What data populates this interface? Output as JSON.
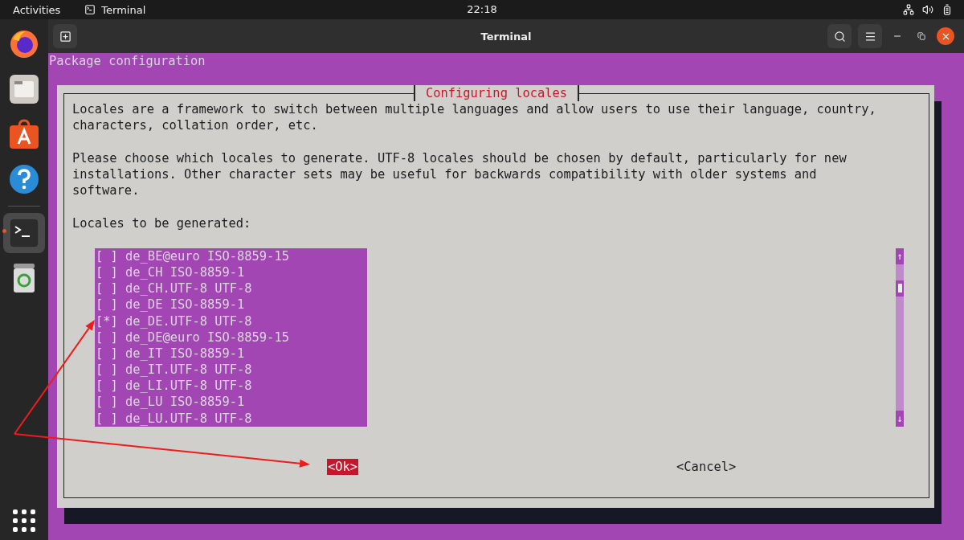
{
  "top_bar": {
    "activities": "Activities",
    "app": "Terminal",
    "clock": "22:18"
  },
  "window": {
    "title": "Terminal"
  },
  "terminal": {
    "header": "Package configuration",
    "dialog": {
      "title": "Configuring locales",
      "paragraphs": [
        "Locales are a framework to switch between multiple languages and allow users to use their language, country,\ncharacters, collation order, etc.",
        "Please choose which locales to generate. UTF-8 locales should be chosen by default, particularly for new\ninstallations. Other character sets may be useful for backwards compatibility with older systems and\nsoftware."
      ],
      "prompt": "Locales to be generated:",
      "checkbox": {
        "on": "[*]",
        "off": "[ ]"
      },
      "locales": [
        {
          "label": "de_BE@euro ISO-8859-15",
          "checked": false
        },
        {
          "label": "de_CH ISO-8859-1",
          "checked": false
        },
        {
          "label": "de_CH.UTF-8 UTF-8",
          "checked": false
        },
        {
          "label": "de_DE ISO-8859-1",
          "checked": false
        },
        {
          "label": "de_DE.UTF-8 UTF-8",
          "checked": true
        },
        {
          "label": "de_DE@euro ISO-8859-15",
          "checked": false
        },
        {
          "label": "de_IT ISO-8859-1",
          "checked": false
        },
        {
          "label": "de_IT.UTF-8 UTF-8",
          "checked": false
        },
        {
          "label": "de_LI.UTF-8 UTF-8",
          "checked": false
        },
        {
          "label": "de_LU ISO-8859-1",
          "checked": false
        },
        {
          "label": "de_LU.UTF-8 UTF-8",
          "checked": false
        }
      ],
      "scroll_up": "↑",
      "scroll_down": "↓",
      "buttons": [
        {
          "label": "<Ok>",
          "selected": true
        },
        {
          "label": "<Cancel>",
          "selected": false
        }
      ]
    }
  }
}
